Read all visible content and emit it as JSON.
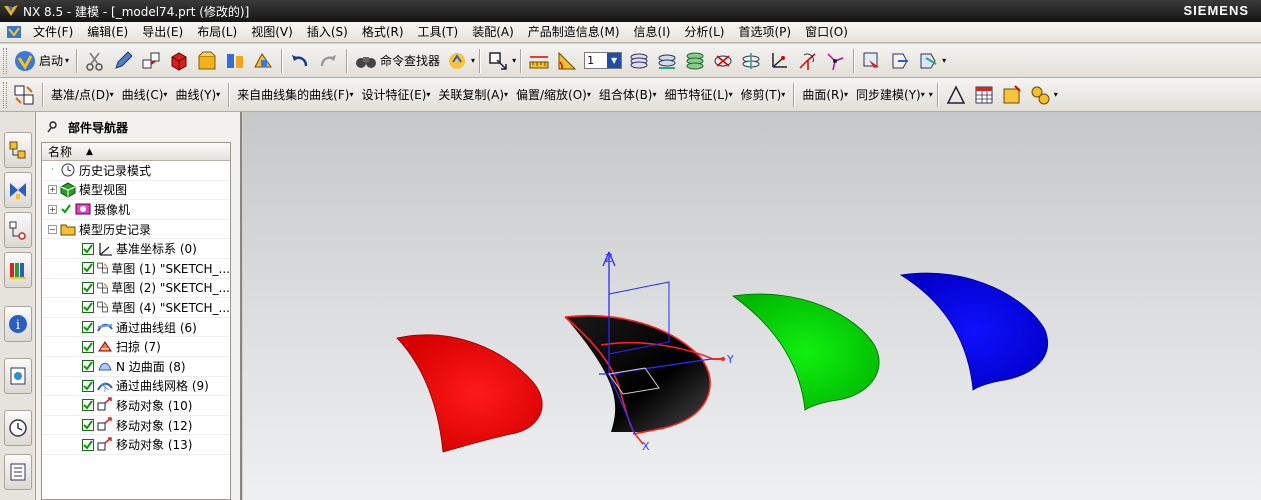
{
  "window": {
    "title": "NX 8.5 - 建模 - [_model74.prt (修改的)]",
    "brand": "SIEMENS"
  },
  "menubar": {
    "items": [
      "文件(F)",
      "编辑(E)",
      "导出(E)",
      "布局(L)",
      "视图(V)",
      "插入(S)",
      "格式(R)",
      "工具(T)",
      "装配(A)",
      "产品制造信息(M)",
      "信息(I)",
      "分析(L)",
      "首选项(P)",
      "窗口(O)"
    ]
  },
  "toolbar1": {
    "start_label": "启动",
    "command_finder_label": "命令查找器",
    "layer_value": "1"
  },
  "toolbar2": {
    "items": [
      "基准/点(D)",
      "曲线(C)",
      "曲线(Y)",
      "来自曲线集的曲线(F)",
      "设计特征(E)",
      "关联复制(A)",
      "偏置/缩放(O)",
      "组合体(B)",
      "细节特征(L)",
      "修剪(T)",
      "曲面(R)",
      "同步建模(Y)"
    ]
  },
  "navigator": {
    "title": "部件导航器",
    "column_name": "名称",
    "rows": [
      {
        "label": "历史记录模式",
        "level": 0,
        "expander": "",
        "checked": false,
        "icon": "clock-icon"
      },
      {
        "label": "模型视图",
        "level": 0,
        "expander": "+",
        "checked": false,
        "icon": "model-views-icon"
      },
      {
        "label": "摄像机",
        "level": 0,
        "expander": "+",
        "checked": true,
        "icon": "camera-icon"
      },
      {
        "label": "模型历史记录",
        "level": 0,
        "expander": "-",
        "checked": false,
        "icon": "folder-icon"
      },
      {
        "label": "基准坐标系 (0)",
        "level": 1,
        "checked": true,
        "icon": "datum-csys-icon"
      },
      {
        "label": "草图 (1) \"SKETCH_...",
        "level": 1,
        "checked": true,
        "icon": "sketch-icon"
      },
      {
        "label": "草图 (2) \"SKETCH_...",
        "level": 1,
        "checked": true,
        "icon": "sketch-icon"
      },
      {
        "label": "草图 (4) \"SKETCH_...",
        "level": 1,
        "checked": true,
        "icon": "sketch-icon"
      },
      {
        "label": "通过曲线组 (6)",
        "level": 1,
        "checked": true,
        "icon": "through-curves-icon"
      },
      {
        "label": "扫掠 (7)",
        "level": 1,
        "checked": true,
        "icon": "swept-icon"
      },
      {
        "label": "N 边曲面 (8)",
        "level": 1,
        "checked": true,
        "icon": "n-sided-surface-icon"
      },
      {
        "label": "通过曲线网格 (9)",
        "level": 1,
        "checked": true,
        "icon": "curve-mesh-icon"
      },
      {
        "label": "移动对象 (10)",
        "level": 1,
        "checked": true,
        "icon": "move-object-icon"
      },
      {
        "label": "移动对象 (12)",
        "level": 1,
        "checked": true,
        "icon": "move-object-icon"
      },
      {
        "label": "移动对象 (13)",
        "level": 1,
        "checked": true,
        "icon": "move-object-icon"
      }
    ]
  },
  "viewport": {
    "axis_labels": {
      "z": "Z",
      "y": "Y",
      "x": "X"
    },
    "shapes": [
      {
        "name": "red-surface",
        "color": "#ff0000"
      },
      {
        "name": "black-surface",
        "color": "#000000"
      },
      {
        "name": "green-surface",
        "color": "#00dd00"
      },
      {
        "name": "blue-surface",
        "color": "#0000ee"
      }
    ]
  }
}
